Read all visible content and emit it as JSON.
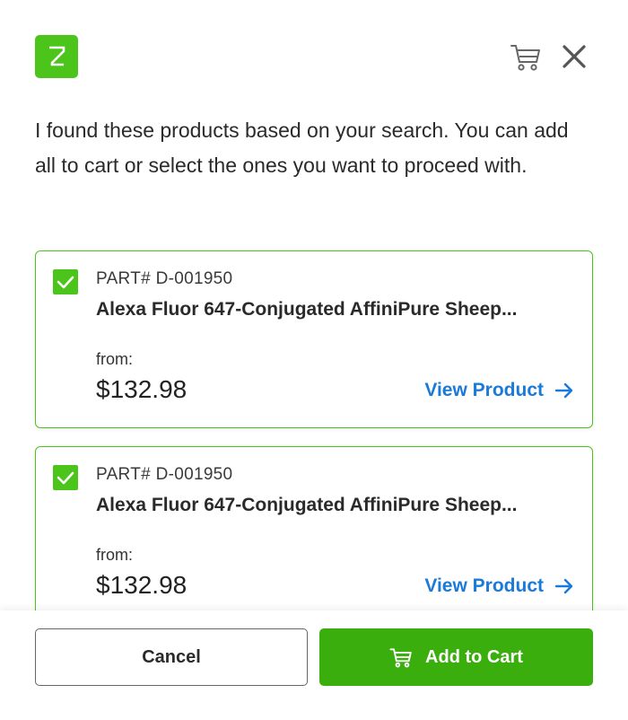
{
  "header": {
    "logo_icon": "z-logo",
    "cart_icon": "cart-icon",
    "close_icon": "close-icon"
  },
  "intro_text": "I found these products based on your search. You can add all to cart or select the ones you want to proceed with.",
  "products": [
    {
      "checked": true,
      "part": "PART# D-001950",
      "name": "Alexa Fluor 647-Conjugated AffiniPure Sheep...",
      "from_label": "from:",
      "price": "$132.98",
      "link_label": "View Product"
    },
    {
      "checked": true,
      "part": "PART# D-001950",
      "name": "Alexa Fluor 647-Conjugated AffiniPure Sheep...",
      "from_label": "from:",
      "price": "$132.98",
      "link_label": "View Product"
    }
  ],
  "footer": {
    "cancel_label": "Cancel",
    "add_label": "Add to Cart"
  },
  "colors": {
    "brand_green": "#4cc51a",
    "button_green": "#3aae0d",
    "link_blue": "#1b7ad8"
  }
}
